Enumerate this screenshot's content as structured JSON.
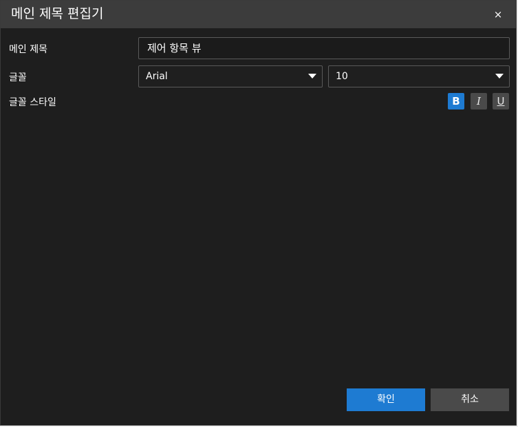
{
  "dialog": {
    "title": "메인 제목 편집기",
    "close_glyph": "×"
  },
  "form": {
    "title_label": "메인 제목",
    "title_value": "제어 항목 뷰",
    "font_label": "글꼴",
    "font_family": "Arial",
    "font_size": "10",
    "style_label": "글꼴 스타일",
    "style_buttons": {
      "bold": "B",
      "italic": "I",
      "underline": "U"
    },
    "style_state": {
      "bold": true,
      "italic": false,
      "underline": false
    }
  },
  "buttons": {
    "ok": "확인",
    "cancel": "취소"
  },
  "colors": {
    "accent": "#1e7bd2",
    "background": "#1e1e1e",
    "titlebar": "#3c3c3c",
    "inactive_button": "#4a4a4a"
  }
}
